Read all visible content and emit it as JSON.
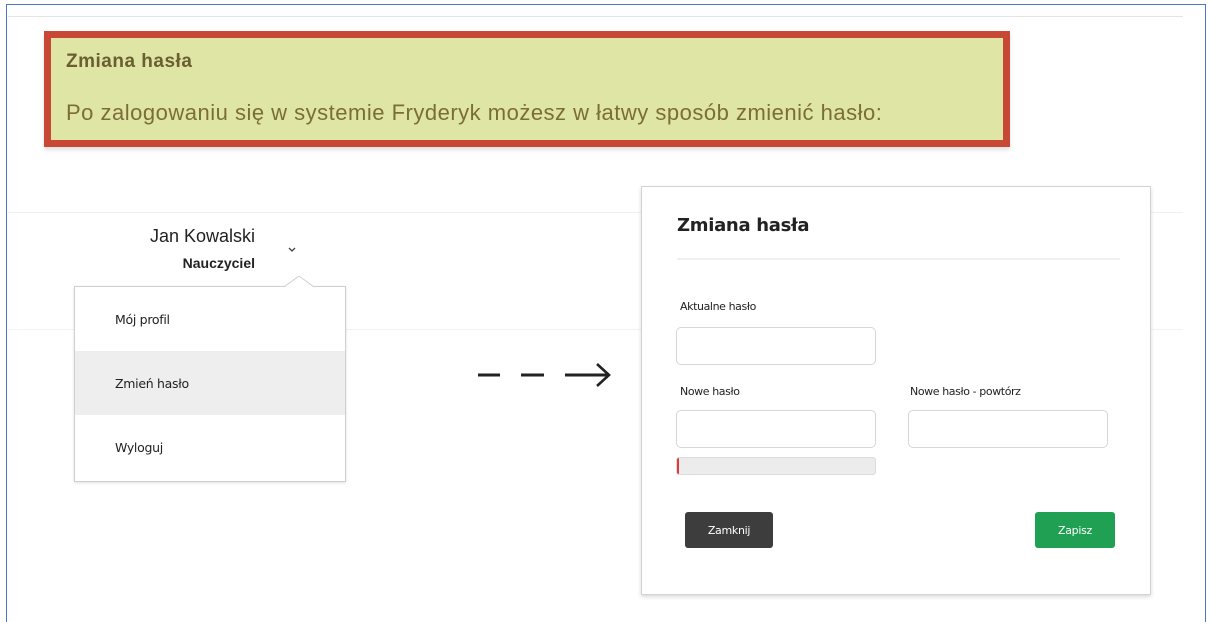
{
  "notice": {
    "title": "Zmiana hasła",
    "text": "Po zalogowaniu się w systemie Fryderyk możesz w łatwy sposób zmienić hasło:"
  },
  "user": {
    "name": "Jan Kowalski",
    "role": "Nauczyciel",
    "chevron_icon": "chevron-down-icon"
  },
  "menu": {
    "items": [
      {
        "label": "Mój profil",
        "active": false
      },
      {
        "label": "Zmień hasło",
        "active": true
      },
      {
        "label": "Wyloguj",
        "active": false
      }
    ]
  },
  "arrow_icon": "dashed-arrow-right-icon",
  "modal": {
    "title": "Zmiana hasła",
    "current_password": {
      "label": "Aktualne hasło",
      "value": ""
    },
    "new_password": {
      "label": "Nowe hasło",
      "value": ""
    },
    "repeat_password": {
      "label": "Nowe hasło - powtórz",
      "value": ""
    },
    "strength": {
      "fraction": 0.012,
      "color": "#e23b3b"
    },
    "close_label": "Zamknij",
    "save_label": "Zapisz"
  },
  "colors": {
    "notice_bg": "#dfe6a5",
    "notice_border": "#c64835",
    "save_button": "#1fa052",
    "close_button": "#3d3d3d"
  }
}
